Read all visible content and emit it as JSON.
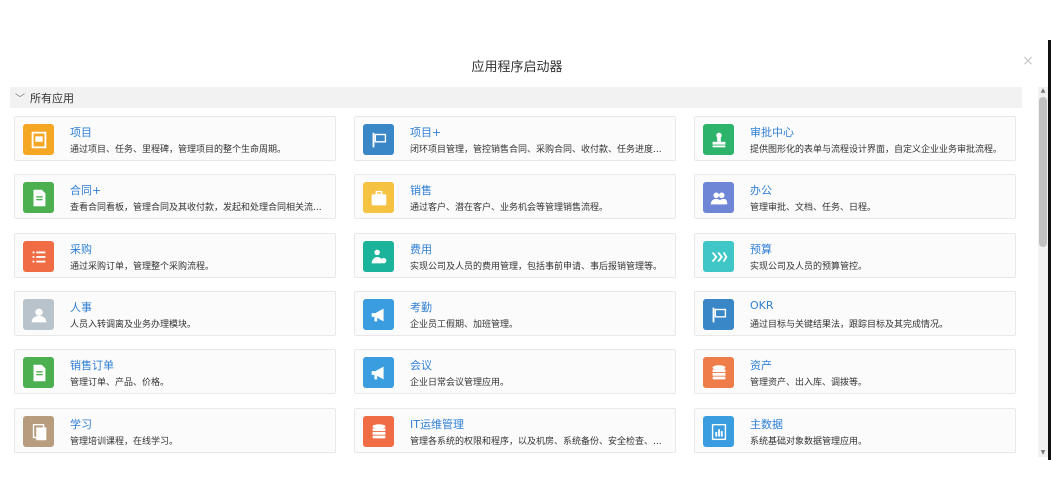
{
  "dialog": {
    "title": "应用程序启动器",
    "close_label": "×"
  },
  "section": {
    "label": "所有应用",
    "chevron": "﹀"
  },
  "apps": [
    {
      "name": "项目",
      "desc": "通过项目、任务、里程碑，管理项目的整个生命周期。",
      "color": "#f5a623",
      "icon": "project-icon"
    },
    {
      "name": "项目+",
      "desc": "闭环项目管理，管控销售合同、采购合同、收付款、任务进度...",
      "color": "#3a87c8",
      "icon": "project-plus-icon"
    },
    {
      "name": "审批中心",
      "desc": "提供图形化的表单与流程设计界面，自定义企业业务审批流程。",
      "color": "#2eb36b",
      "icon": "approval-stamp-icon"
    },
    {
      "name": "合同+",
      "desc": "查看合同看板，管理合同及其收付款，发起和处理合同相关流...",
      "color": "#4caf50",
      "icon": "contract-icon"
    },
    {
      "name": "销售",
      "desc": "通过客户、潜在客户、业务机会等管理销售流程。",
      "color": "#f5c242",
      "icon": "briefcase-icon"
    },
    {
      "name": "办公",
      "desc": "管理审批、文档、任务、日程。",
      "color": "#6f86d6",
      "icon": "people-icon"
    },
    {
      "name": "采购",
      "desc": "通过采购订单，管理整个采购流程。",
      "color": "#ef6c45",
      "icon": "list-icon"
    },
    {
      "name": "费用",
      "desc": "实现公司及人员的费用管理，包括事前申请、事后报销管理等。",
      "color": "#1bb39a",
      "icon": "expense-icon"
    },
    {
      "name": "预算",
      "desc": "实现公司及人员的预算管控。",
      "color": "#3fc6c6",
      "icon": "budget-icon"
    },
    {
      "name": "人事",
      "desc": "人员入转调离及业务办理模块。",
      "color": "#b8c3cc",
      "icon": "person-icon"
    },
    {
      "name": "考勤",
      "desc": "企业员工假期、加班管理。",
      "color": "#3a9de0",
      "icon": "megaphone-icon"
    },
    {
      "name": "OKR",
      "desc": "通过目标与关键结果法，跟踪目标及其完成情况。",
      "color": "#3a87c8",
      "icon": "okr-icon"
    },
    {
      "name": "销售订单",
      "desc": "管理订单、产品、价格。",
      "color": "#4caf50",
      "icon": "sales-order-icon"
    },
    {
      "name": "会议",
      "desc": "企业日常会议管理应用。",
      "color": "#3a9de0",
      "icon": "meeting-icon"
    },
    {
      "name": "资产",
      "desc": "管理资产、出入库、调拨等。",
      "color": "#ef7d4a",
      "icon": "asset-icon"
    },
    {
      "name": "学习",
      "desc": "管理培训课程，在线学习。",
      "color": "#b89c7e",
      "icon": "learning-icon"
    },
    {
      "name": "IT运维管理",
      "desc": "管理各系统的权限和程序，以及机房、系统备份、安全检查、...",
      "color": "#ef6c45",
      "icon": "it-ops-icon"
    },
    {
      "name": "主数据",
      "desc": "系统基础对象数据管理应用。",
      "color": "#3a9de0",
      "icon": "master-data-icon"
    }
  ]
}
